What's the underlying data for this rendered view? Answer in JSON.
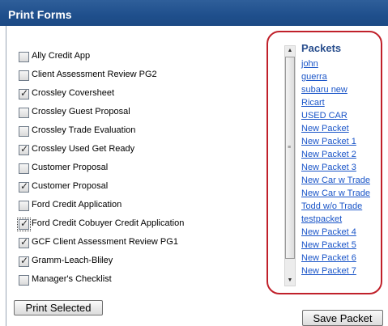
{
  "window": {
    "title": "Print Forms"
  },
  "forms": [
    {
      "label": "Ally Credit App",
      "checked": false,
      "focused": false
    },
    {
      "label": "Client Assessment Review PG2",
      "checked": false,
      "focused": false
    },
    {
      "label": "Crossley Coversheet",
      "checked": true,
      "focused": false
    },
    {
      "label": "Crossley Guest Proposal",
      "checked": false,
      "focused": false
    },
    {
      "label": "Crossley Trade Evaluation",
      "checked": false,
      "focused": false
    },
    {
      "label": "Crossley Used Get Ready",
      "checked": true,
      "focused": false
    },
    {
      "label": "Customer Proposal",
      "checked": false,
      "focused": false
    },
    {
      "label": "Customer Proposal",
      "checked": true,
      "focused": false
    },
    {
      "label": "Ford Credit Application",
      "checked": false,
      "focused": false
    },
    {
      "label": "Ford Credit Cobuyer Credit Application",
      "checked": true,
      "focused": true
    },
    {
      "label": "GCF Client Assessment Review PG1",
      "checked": true,
      "focused": false
    },
    {
      "label": "Gramm-Leach-Bliley",
      "checked": true,
      "focused": false
    },
    {
      "label": "Manager's Checklist",
      "checked": false,
      "focused": false
    }
  ],
  "packets": {
    "title": "Packets",
    "items": [
      "john",
      "guerra",
      "subaru new",
      "Ricart",
      "USED CAR",
      "New Packet",
      "New Packet 1",
      "New Packet 2",
      "New Packet 3",
      "New Car w Trade",
      "New Car w Trade",
      "Todd w/o Trade",
      "testpacket",
      "New Packet 4",
      "New Packet 5",
      "New Packet 6",
      "New Packet 7"
    ]
  },
  "buttons": {
    "print_selected": "Print Selected",
    "save_packet": "Save Packet"
  },
  "colors": {
    "title_bar": "#1f4f8c",
    "highlight_border": "#c0202a",
    "link": "#1a55c8",
    "packets_title": "#2a4f8e"
  }
}
